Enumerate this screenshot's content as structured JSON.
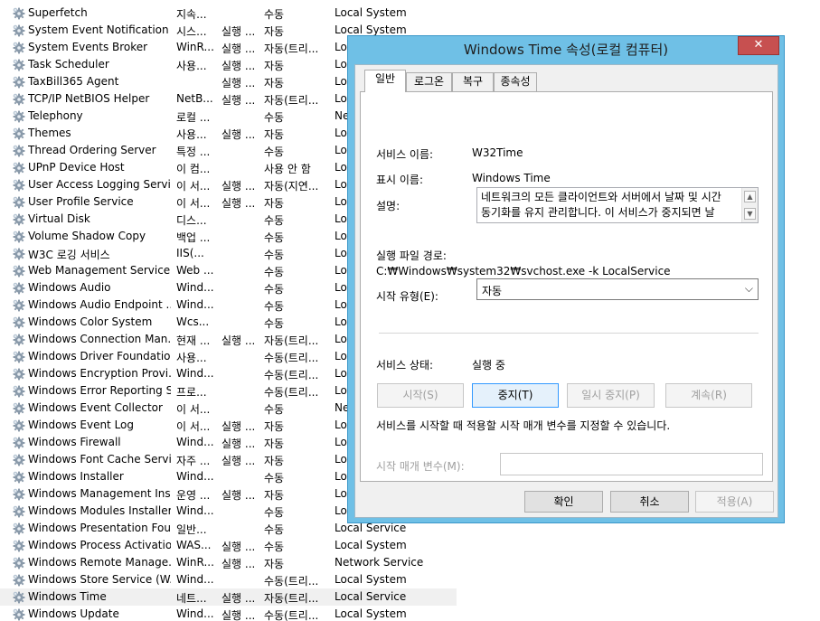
{
  "services": [
    {
      "name": "Superfetch",
      "desc": "지속...",
      "status": "",
      "startup": "수동",
      "logon": "Local System"
    },
    {
      "name": "System Event Notification ...",
      "desc": "시스...",
      "status": "실행 ...",
      "startup": "자동",
      "logon": "Local System"
    },
    {
      "name": "System Events Broker",
      "desc": "WinR...",
      "status": "실행 ...",
      "startup": "자동(트리...",
      "logon": "Local System"
    },
    {
      "name": "Task Scheduler",
      "desc": "사용...",
      "status": "실행 ...",
      "startup": "자동",
      "logon": "Local System"
    },
    {
      "name": "TaxBill365 Agent",
      "desc": "",
      "status": "실행 ...",
      "startup": "자동",
      "logon": "Local System"
    },
    {
      "name": "TCP/IP NetBIOS Helper",
      "desc": "NetB...",
      "status": "실행 ...",
      "startup": "자동(트리...",
      "logon": "Local Service"
    },
    {
      "name": "Telephony",
      "desc": "로컬 ...",
      "status": "",
      "startup": "수동",
      "logon": "Network Service"
    },
    {
      "name": "Themes",
      "desc": "사용...",
      "status": "실행 ...",
      "startup": "자동",
      "logon": "Local System"
    },
    {
      "name": "Thread Ordering Server",
      "desc": "특정 ...",
      "status": "",
      "startup": "수동",
      "logon": "Local Service"
    },
    {
      "name": "UPnP Device Host",
      "desc": "이 컴...",
      "status": "",
      "startup": "사용 안 함",
      "logon": "Local Service"
    },
    {
      "name": "User Access Logging Service",
      "desc": "이 서...",
      "status": "실행 ...",
      "startup": "자동(지연...",
      "logon": "Local System"
    },
    {
      "name": "User Profile Service",
      "desc": "이 서...",
      "status": "실행 ...",
      "startup": "자동",
      "logon": "Local System"
    },
    {
      "name": "Virtual Disk",
      "desc": "디스...",
      "status": "",
      "startup": "수동",
      "logon": "Local System"
    },
    {
      "name": "Volume Shadow Copy",
      "desc": "백업 ...",
      "status": "",
      "startup": "수동",
      "logon": "Local System"
    },
    {
      "name": "W3C 로깅 서비스",
      "desc": "IIS(...",
      "status": "",
      "startup": "수동",
      "logon": "Local System"
    },
    {
      "name": "Web Management Service",
      "desc": "Web ...",
      "status": "",
      "startup": "수동",
      "logon": "Local Service"
    },
    {
      "name": "Windows Audio",
      "desc": "Wind...",
      "status": "",
      "startup": "수동",
      "logon": "Local Service"
    },
    {
      "name": "Windows Audio Endpoint ...",
      "desc": "Wind...",
      "status": "",
      "startup": "수동",
      "logon": "Local System"
    },
    {
      "name": "Windows Color System",
      "desc": "Wcs...",
      "status": "",
      "startup": "수동",
      "logon": "Local Service"
    },
    {
      "name": "Windows Connection Man...",
      "desc": "현재 ...",
      "status": "실행 ...",
      "startup": "자동(트리...",
      "logon": "Local Service"
    },
    {
      "name": "Windows Driver Foundatio...",
      "desc": "사용...",
      "status": "",
      "startup": "수동(트리...",
      "logon": "Local System"
    },
    {
      "name": "Windows Encryption Provi...",
      "desc": "Wind...",
      "status": "",
      "startup": "수동(트리...",
      "logon": "Local Service"
    },
    {
      "name": "Windows Error Reporting S...",
      "desc": "프로...",
      "status": "",
      "startup": "수동(트리...",
      "logon": "Local System"
    },
    {
      "name": "Windows Event Collector",
      "desc": "이 서...",
      "status": "",
      "startup": "수동",
      "logon": "Network Service"
    },
    {
      "name": "Windows Event Log",
      "desc": "이 서...",
      "status": "실행 ...",
      "startup": "자동",
      "logon": "Local Service"
    },
    {
      "name": "Windows Firewall",
      "desc": "Wind...",
      "status": "실행 ...",
      "startup": "자동",
      "logon": "Local Service"
    },
    {
      "name": "Windows Font Cache Service",
      "desc": "자주 ...",
      "status": "실행 ...",
      "startup": "자동",
      "logon": "Local Service"
    },
    {
      "name": "Windows Installer",
      "desc": "Wind...",
      "status": "",
      "startup": "수동",
      "logon": "Local System"
    },
    {
      "name": "Windows Management Inst...",
      "desc": "운영 ...",
      "status": "실행 ...",
      "startup": "자동",
      "logon": "Local System"
    },
    {
      "name": "Windows Modules Installer",
      "desc": "Wind...",
      "status": "",
      "startup": "수동",
      "logon": "Local System"
    },
    {
      "name": "Windows Presentation Fou...",
      "desc": "일반...",
      "status": "",
      "startup": "수동",
      "logon": "Local Service"
    },
    {
      "name": "Windows Process Activatio...",
      "desc": "WAS...",
      "status": "실행 ...",
      "startup": "수동",
      "logon": "Local System"
    },
    {
      "name": "Windows Remote Manage...",
      "desc": "WinR...",
      "status": "실행 ...",
      "startup": "자동",
      "logon": "Network Service"
    },
    {
      "name": "Windows Store Service (W...",
      "desc": "Wind...",
      "status": "",
      "startup": "수동(트리...",
      "logon": "Local System"
    },
    {
      "name": "Windows Time",
      "desc": "네트...",
      "status": "실행 ...",
      "startup": "자동(트리...",
      "logon": "Local Service"
    },
    {
      "name": "Windows Update",
      "desc": "Wind...",
      "status": "실행 ...",
      "startup": "수동(트리...",
      "logon": "Local System"
    }
  ],
  "selected_service": "Windows Time",
  "dialog": {
    "title": "Windows Time 속성(로컬 컴퓨터)",
    "close_glyph": "✕",
    "tabs": [
      "일반",
      "로그온",
      "복구",
      "종속성"
    ],
    "active_tab": "일반",
    "service_name_label": "서비스 이름:",
    "service_name": "W32Time",
    "display_name_label": "표시 이름:",
    "display_name": "Windows Time",
    "description_label": "설명:",
    "description_line1": "네트워크의 모든 클라이언트와 서버에서 날짜 및 시간",
    "description_line2": "동기화를 유지 관리합니다. 이 서비스가 중지되면 날",
    "exe_path_label": "실행 파일 경로:",
    "exe_path": "C:₩Windows₩system32₩svchost.exe -k LocalService",
    "startup_type_label": "시작 유형(E):",
    "startup_type": "자동",
    "status_label": "서비스 상태:",
    "status_value": "실행 중",
    "start_button": "시작(S)",
    "stop_button": "중지(T)",
    "pause_button": "일시 중지(P)",
    "resume_button": "계속(R)",
    "params_hint": "서비스를 시작할 때 적용할 시작 매개 변수를 지정할 수 있습니다.",
    "params_label": "시작 매개 변수(M):",
    "params_value": "",
    "ok_button": "확인",
    "cancel_button": "취소",
    "apply_button": "적용(A)"
  },
  "colors": {
    "dialog_frame": "#6fc0e6",
    "close_button": "#c75050",
    "selected_row": "#f0f0f0"
  },
  "icons": {
    "service": "gear-icon",
    "close": "close-icon",
    "dropdown": "chevron-down-icon",
    "scroll_up": "scroll-up-icon",
    "scroll_down": "scroll-down-icon"
  }
}
